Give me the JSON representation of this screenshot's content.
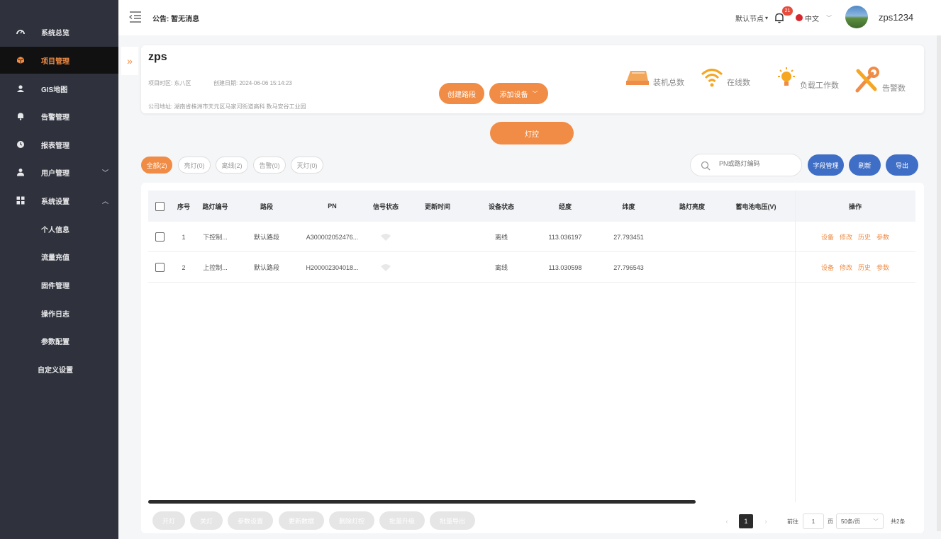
{
  "sidebar": {
    "items": [
      {
        "label": "系统总览",
        "icon": "dashboard-icon"
      },
      {
        "label": "项目管理",
        "icon": "cube-icon"
      },
      {
        "label": "GIS地图",
        "icon": "user-map-icon"
      },
      {
        "label": "告警管理",
        "icon": "bell-icon"
      },
      {
        "label": "报表管理",
        "icon": "clock-icon"
      },
      {
        "label": "用户管理",
        "icon": "user-icon"
      },
      {
        "label": "系统设置",
        "icon": "grid-icon"
      }
    ],
    "subitems": [
      "个人信息",
      "流量充值",
      "固件管理",
      "操作日志",
      "参数配置",
      "自定义设置"
    ]
  },
  "topbar": {
    "notice": "公告: 暂无消息",
    "node": "默认节点",
    "badge": "21",
    "language": "中文",
    "username": "zps1234"
  },
  "project": {
    "name": "zps",
    "region": "项目时区: 东八区",
    "created": "创建日期: 2024-06-06 15:14:23",
    "address": "公司地址: 湖南省株洲市天元区马家河街道高科 数马安谷工业园",
    "create_road_label": "创建路段",
    "add_device_label": "添加设备",
    "light_control_label": "灯控",
    "stats": [
      {
        "label": "装机总数",
        "icon": "lamp-box-icon"
      },
      {
        "label": "在线数",
        "icon": "wifi-icon"
      },
      {
        "label": "负载工作数",
        "icon": "bulb-icon"
      },
      {
        "label": "告警数",
        "icon": "tools-icon"
      }
    ]
  },
  "filters": [
    "全部(2)",
    "亮灯(0)",
    "离线(2)",
    "告警(0)",
    "灭灯(0)"
  ],
  "search": {
    "placeholder": "PN或路灯编码"
  },
  "actions": {
    "field_manage": "字段管理",
    "refresh": "刷新",
    "export": "导出"
  },
  "table": {
    "headers": [
      "序号",
      "路灯编号",
      "路段",
      "PN",
      "信号状态",
      "更新时间",
      "设备状态",
      "经度",
      "纬度",
      "路灯亮度",
      "蓄电池电压(V)",
      "操作"
    ],
    "rows": [
      {
        "no": "1",
        "code": "下控制...",
        "road": "默认路段",
        "pn": "A300002052476...",
        "updated": "",
        "status": "离线",
        "lng": "113.036197",
        "lat": "27.793451",
        "brightness": "",
        "voltage": ""
      },
      {
        "no": "2",
        "code": "上控制...",
        "road": "默认路段",
        "pn": "H200002304018...",
        "updated": "",
        "status": "离线",
        "lng": "113.030598",
        "lat": "27.796543",
        "brightness": "",
        "voltage": ""
      }
    ],
    "ops": [
      "设备",
      "修改",
      "历史",
      "参数"
    ]
  },
  "footer": {
    "buttons": [
      "开灯",
      "关灯",
      "参数设置",
      "更新数据",
      "删除灯控",
      "批量升级",
      "批量导出"
    ],
    "page": "1",
    "goto_label": "前往",
    "goto_value": "1",
    "page_unit": "页",
    "page_size": "50条/页",
    "total": "共2条"
  },
  "colors": {
    "accent": "#f08c45",
    "primary": "#3f6ec6",
    "sidebar": "#2f323d"
  }
}
